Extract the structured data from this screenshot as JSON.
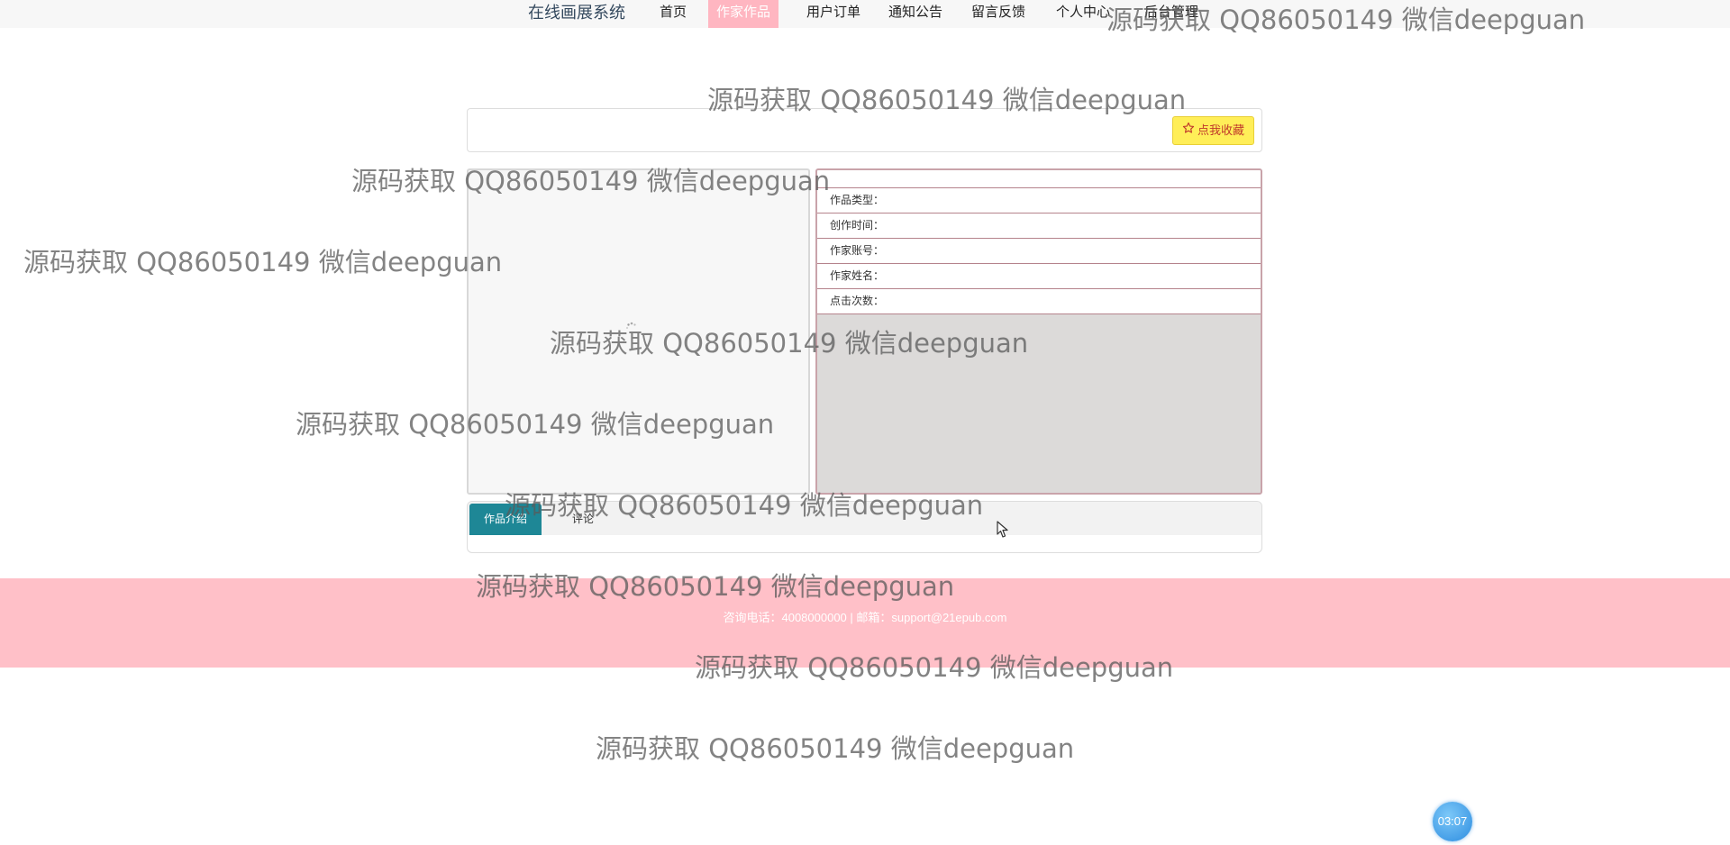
{
  "app": {
    "brand": "在线画展系统"
  },
  "nav": {
    "items": [
      {
        "label": "首页",
        "active": false
      },
      {
        "label": "作家作品",
        "active": true
      },
      {
        "label": "用户订单",
        "active": false
      },
      {
        "label": "通知公告",
        "active": false
      },
      {
        "label": "留言反馈",
        "active": false
      },
      {
        "label": "个人中心",
        "active": false
      },
      {
        "label": "后台管理",
        "active": false
      }
    ]
  },
  "detail": {
    "title": "",
    "favorite_label": "点我收藏",
    "fields": [
      {
        "label": "作品类型：",
        "value": ""
      },
      {
        "label": "创作时间：",
        "value": ""
      },
      {
        "label": "作家账号：",
        "value": ""
      },
      {
        "label": "作家姓名：",
        "value": ""
      },
      {
        "label": "点击次数：",
        "value": ""
      }
    ]
  },
  "tabs": [
    {
      "label": "作品介绍",
      "active": true
    },
    {
      "label": "评论",
      "active": false
    }
  ],
  "footer": {
    "text": "咨询电话：4008000000 | 邮箱：support@21epub.com"
  },
  "timer": {
    "text": "03:07"
  },
  "watermark": {
    "text": "源码获取 QQ86050149 微信deepguan"
  },
  "colors": {
    "nav_active": "#ffb6c1",
    "favorite_button": "#ffee58",
    "tab_active": "#1e8796",
    "footer": "#ffc0c8",
    "info_border": "#b5838c"
  }
}
